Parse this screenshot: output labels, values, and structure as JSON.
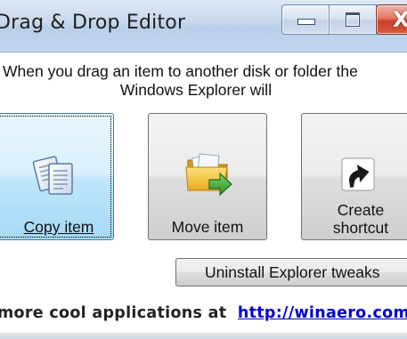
{
  "window": {
    "title": "Drag & Drop Editor",
    "visible_title": "Drag & Drop Editor"
  },
  "instruction": {
    "line1": "When you drag an item to another disk or folder the",
    "line2": "Windows Explorer will"
  },
  "actions": {
    "copy_label": "Copy item",
    "move_label": "Move item",
    "shortcut_line1": "Create",
    "shortcut_line2": "shortcut"
  },
  "uninstall_label": "Uninstall Explorer tweaks",
  "footer": {
    "text": "more  cool applications at",
    "link": "http://winaero.com"
  },
  "icons": {
    "copy": "copy-documents-icon",
    "move": "move-folder-icon",
    "shortcut": "shortcut-arrow-icon",
    "minimize": "minimize-icon",
    "maximize": "maximize-icon",
    "close": "close-icon"
  }
}
